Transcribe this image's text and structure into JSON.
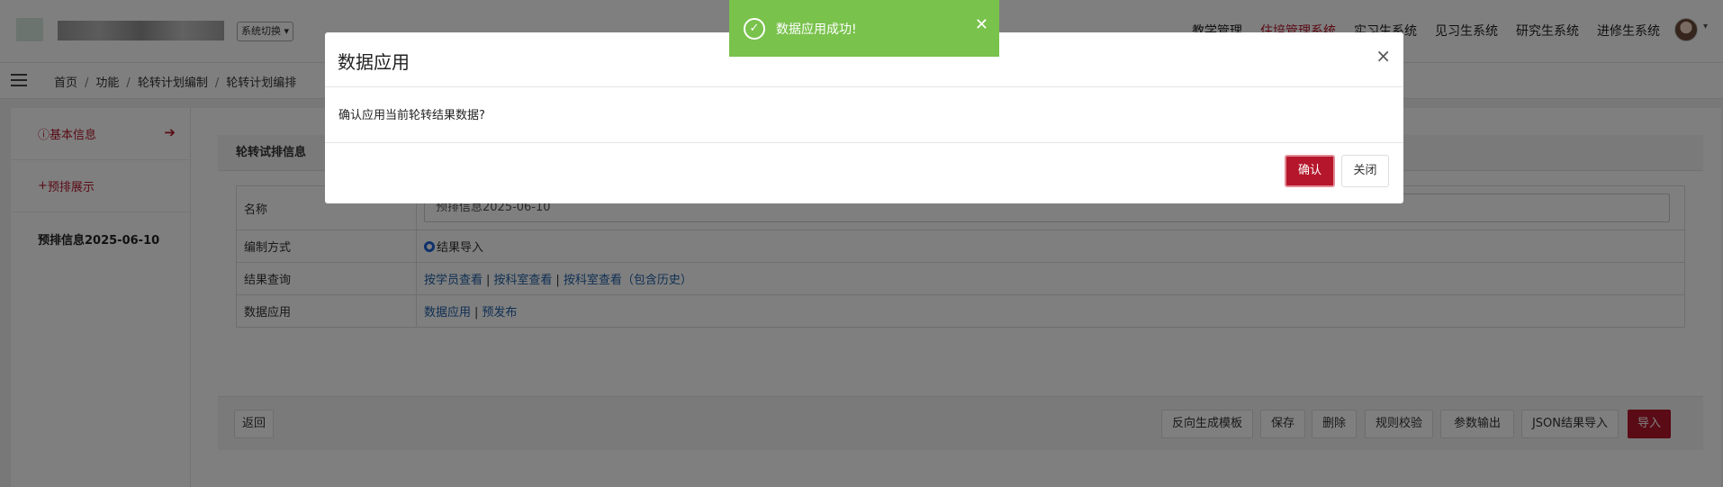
{
  "header": {
    "system_switch": "系统切换",
    "nav": [
      "教学管理",
      "住培管理系统",
      "实习生系统",
      "见习生系统",
      "研究生系统",
      "进修生系统"
    ],
    "active_nav_index": 1,
    "avatar_caret": "▾"
  },
  "breadcrumb": {
    "items": [
      "首页",
      "功能",
      "轮转计划编制",
      "轮转计划编排"
    ],
    "separator": "/"
  },
  "sidebar": {
    "basic_info": "基本信息",
    "pre_schedule": "预排展示",
    "info_name": "预排信息2025-06-10"
  },
  "panel": {
    "title": "轮转试排信息",
    "rows": {
      "name_label": "名称",
      "name_value": "预排信息2025-06-10",
      "method_label": "编制方式",
      "method_option": "结果导入",
      "query_label": "结果查询",
      "query_links": [
        "按学员查看",
        "按科室查看",
        "按科室查看（包含历史）"
      ],
      "apply_label": "数据应用",
      "apply_links": [
        "数据应用",
        "预发布"
      ]
    }
  },
  "buttons": {
    "back": "返回",
    "reverse": "反向生成模板",
    "save": "保存",
    "delete": "删除",
    "rule_check": "规则校验",
    "param_output": "参数输出",
    "json_import": "JSON结果导入",
    "import": "导入"
  },
  "modal": {
    "title": "数据应用",
    "body": "确认应用当前轮转结果数据?",
    "confirm": "确认",
    "close": "关闭",
    "close_icon": "×"
  },
  "toast": {
    "message": "数据应用成功!",
    "close_icon": "✕",
    "check_icon": "✓"
  },
  "colors": {
    "brand_red": "#b5162b",
    "toast_green": "#79c24c",
    "link_blue": "#1f5fa6"
  }
}
